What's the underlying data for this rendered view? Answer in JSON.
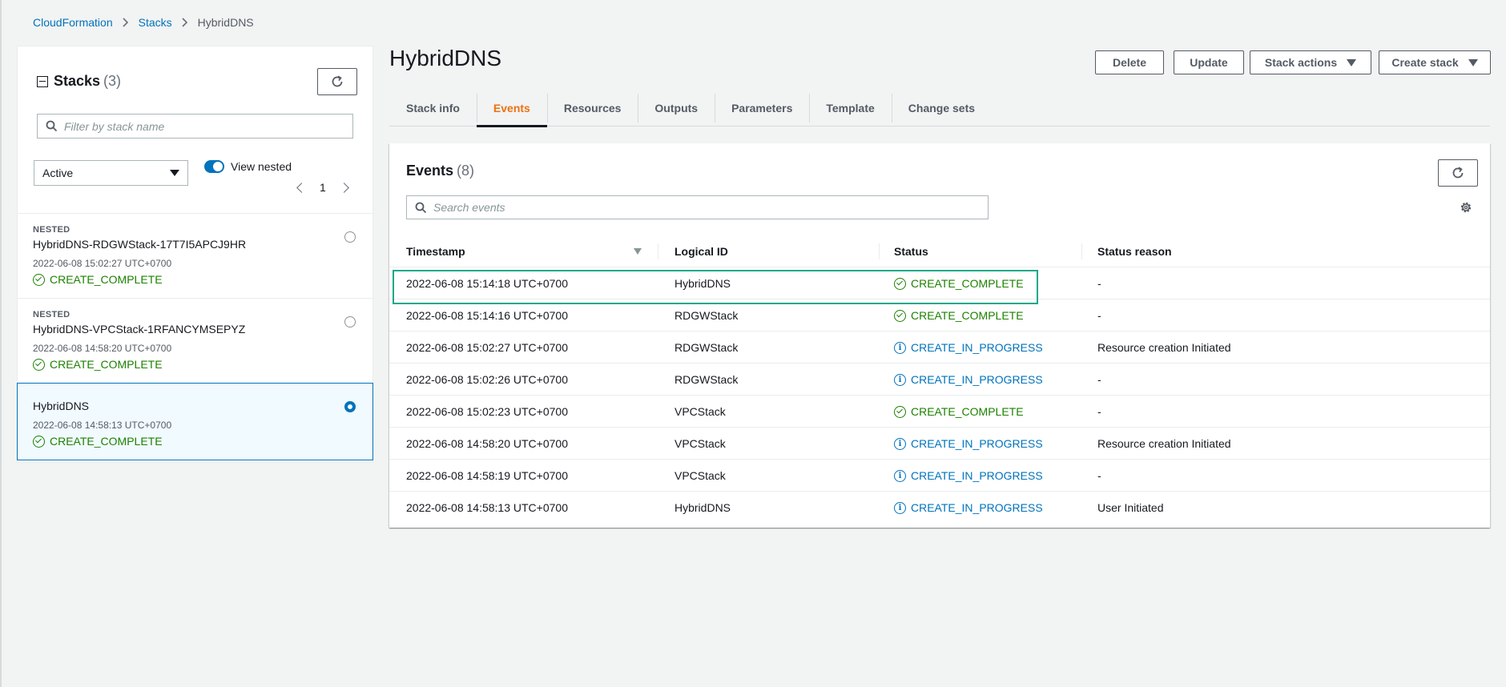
{
  "breadcrumb": {
    "root": "CloudFormation",
    "stacks": "Stacks",
    "current": "HybridDNS"
  },
  "stacks_panel": {
    "title": "Stacks",
    "count": "(3)",
    "filter_placeholder": "Filter by stack name",
    "status_filter": "Active",
    "view_nested_label": "View nested",
    "page": "1",
    "items": [
      {
        "nested_label": "NESTED",
        "name": "HybridDNS-RDGWStack-17T7I5APCJ9HR",
        "date": "2022-06-08 15:02:27 UTC+0700",
        "status": "CREATE_COMPLETE",
        "selected": false
      },
      {
        "nested_label": "NESTED",
        "name": "HybridDNS-VPCStack-1RFANCYMSEPYZ",
        "date": "2022-06-08 14:58:20 UTC+0700",
        "status": "CREATE_COMPLETE",
        "selected": false
      },
      {
        "nested_label": "",
        "name": "HybridDNS",
        "date": "2022-06-08 14:58:13 UTC+0700",
        "status": "CREATE_COMPLETE",
        "selected": true
      }
    ]
  },
  "main": {
    "title": "HybridDNS",
    "actions": {
      "delete": "Delete",
      "update": "Update",
      "stack_actions": "Stack actions",
      "create_stack": "Create stack"
    },
    "tabs": [
      "Stack info",
      "Events",
      "Resources",
      "Outputs",
      "Parameters",
      "Template",
      "Change sets"
    ],
    "active_tab": "Events"
  },
  "events": {
    "title": "Events",
    "count": "(8)",
    "search_placeholder": "Search events",
    "columns": [
      "Timestamp",
      "Logical ID",
      "Status",
      "Status reason"
    ],
    "rows": [
      {
        "timestamp": "2022-06-08 15:14:18 UTC+0700",
        "logical_id": "HybridDNS",
        "status": "CREATE_COMPLETE",
        "kind": "ok",
        "reason": "-"
      },
      {
        "timestamp": "2022-06-08 15:14:16 UTC+0700",
        "logical_id": "RDGWStack",
        "status": "CREATE_COMPLETE",
        "kind": "ok",
        "reason": "-"
      },
      {
        "timestamp": "2022-06-08 15:02:27 UTC+0700",
        "logical_id": "RDGWStack",
        "status": "CREATE_IN_PROGRESS",
        "kind": "info",
        "reason": "Resource creation Initiated"
      },
      {
        "timestamp": "2022-06-08 15:02:26 UTC+0700",
        "logical_id": "RDGWStack",
        "status": "CREATE_IN_PROGRESS",
        "kind": "info",
        "reason": "-"
      },
      {
        "timestamp": "2022-06-08 15:02:23 UTC+0700",
        "logical_id": "VPCStack",
        "status": "CREATE_COMPLETE",
        "kind": "ok",
        "reason": "-"
      },
      {
        "timestamp": "2022-06-08 14:58:20 UTC+0700",
        "logical_id": "VPCStack",
        "status": "CREATE_IN_PROGRESS",
        "kind": "info",
        "reason": "Resource creation Initiated"
      },
      {
        "timestamp": "2022-06-08 14:58:19 UTC+0700",
        "logical_id": "VPCStack",
        "status": "CREATE_IN_PROGRESS",
        "kind": "info",
        "reason": "-"
      },
      {
        "timestamp": "2022-06-08 14:58:13 UTC+0700",
        "logical_id": "HybridDNS",
        "status": "CREATE_IN_PROGRESS",
        "kind": "info",
        "reason": "User Initiated"
      }
    ]
  },
  "colors": {
    "link": "#0073bb",
    "success": "#1d8102",
    "active_tab": "#ec7211",
    "highlight": "#1aa88a"
  }
}
